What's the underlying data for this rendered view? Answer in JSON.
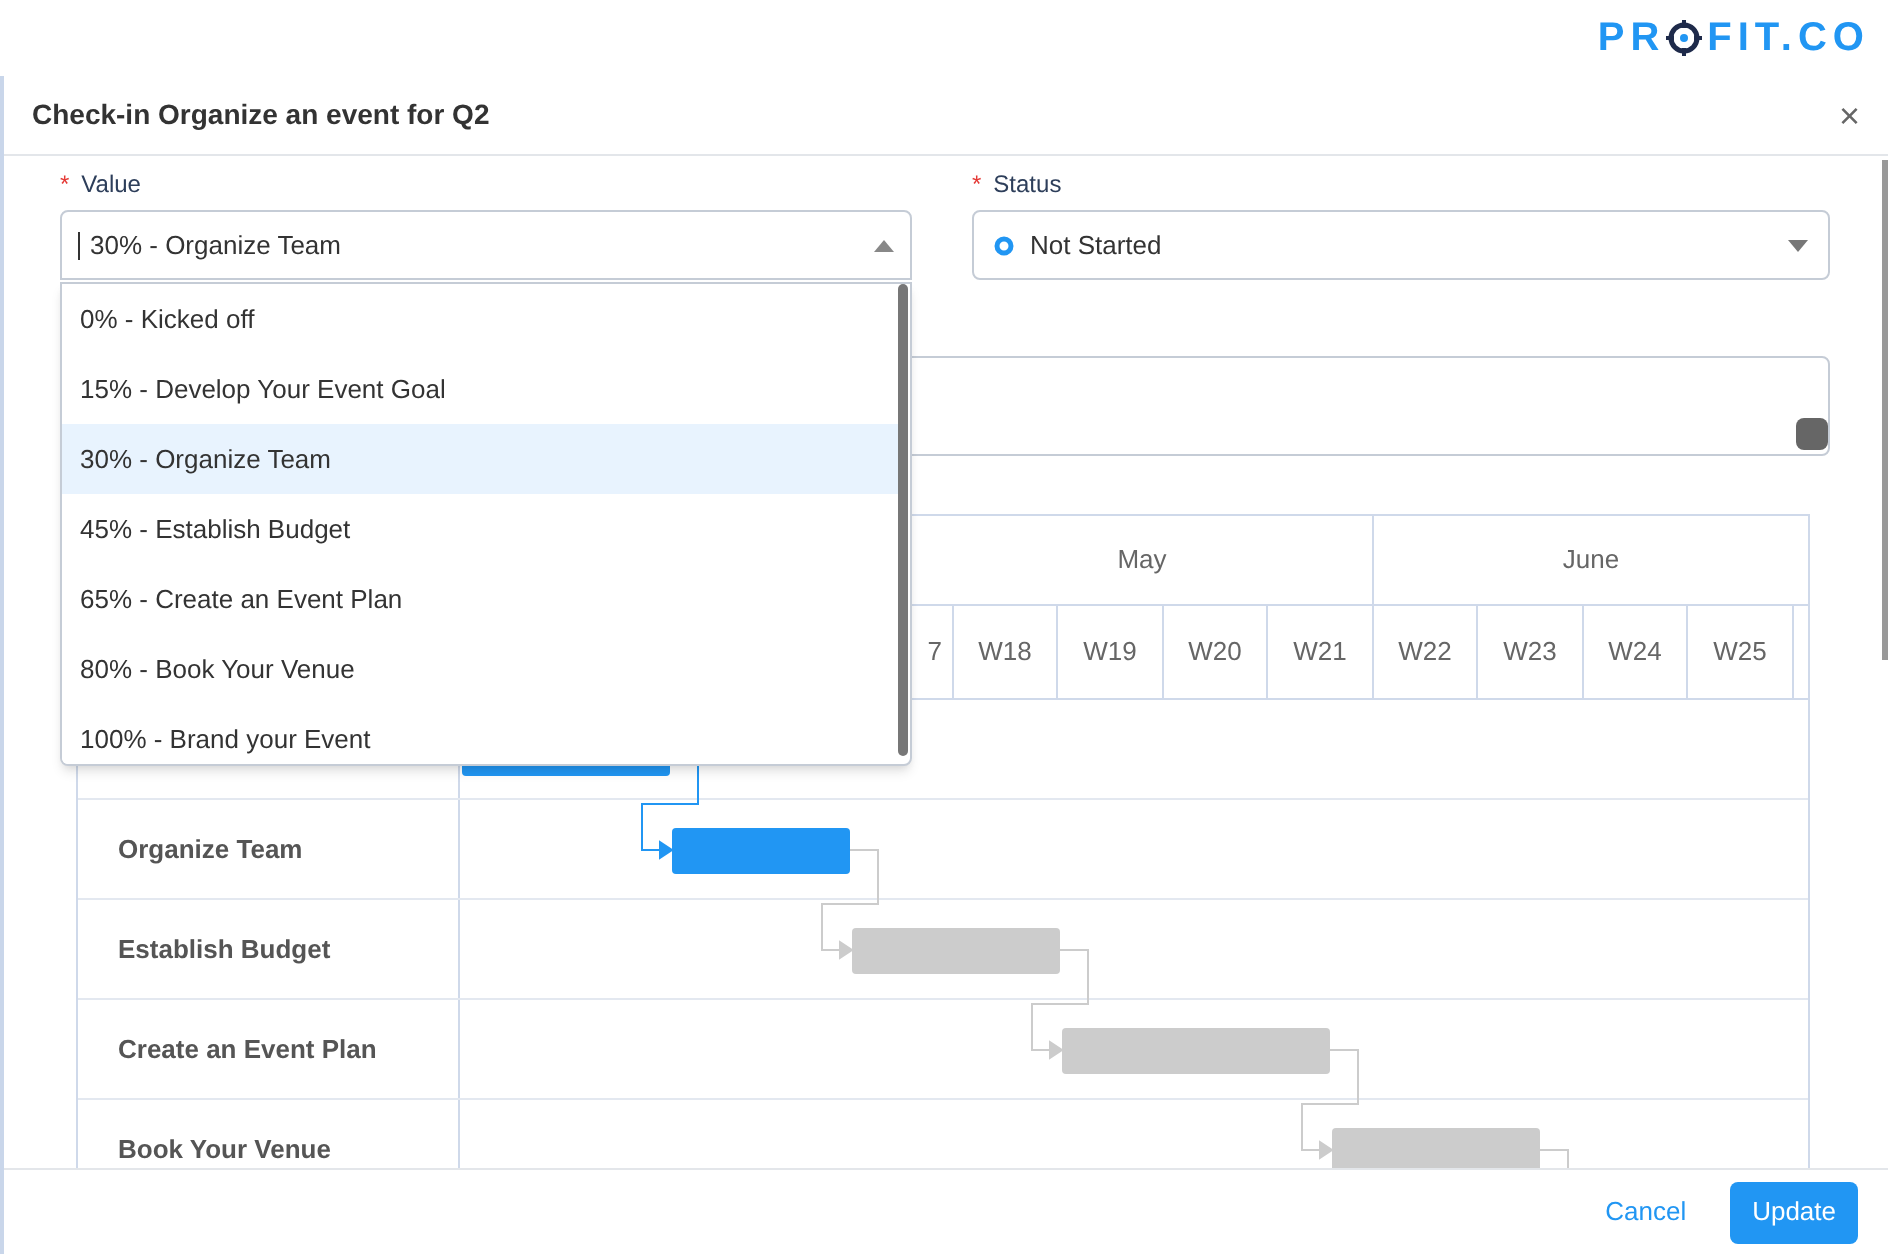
{
  "logo": {
    "before": "PR",
    "after": "FIT.CO"
  },
  "dialog": {
    "title": "Check-in Organize an event for Q2",
    "close": "×"
  },
  "value_field": {
    "label": "Value",
    "required_mark": "*",
    "value": "30% - Organize Team",
    "expanded": true
  },
  "status_field": {
    "label": "Status",
    "required_mark": "*",
    "value": "Not Started"
  },
  "dropdown": {
    "options": [
      {
        "label": "0% - Kicked off",
        "selected": false
      },
      {
        "label": "15% - Develop Your Event Goal",
        "selected": false
      },
      {
        "label": "30% - Organize Team",
        "selected": true
      },
      {
        "label": "45% - Establish Budget",
        "selected": false
      },
      {
        "label": "65% - Create an Event Plan",
        "selected": false
      },
      {
        "label": "80% - Book Your Venue",
        "selected": false
      },
      {
        "label": "100% - Brand your Event",
        "selected": false
      }
    ]
  },
  "gantt": {
    "months": [
      "May",
      "June"
    ],
    "weeks": [
      "7",
      "W18",
      "W19",
      "W20",
      "W21",
      "W22",
      "W23",
      "W24",
      "W25"
    ],
    "tasks": [
      {
        "color": "#2196f3"
      },
      {
        "name": "Organize Team",
        "color": "#2196f3"
      },
      {
        "name": "Establish Budget",
        "color": "#cccccc"
      },
      {
        "name": "Create an Event Plan",
        "color": "#cccccc"
      },
      {
        "name": "Book Your Venue",
        "color": "#cccccc"
      }
    ]
  },
  "footer": {
    "cancel": "Cancel",
    "update": "Update"
  }
}
